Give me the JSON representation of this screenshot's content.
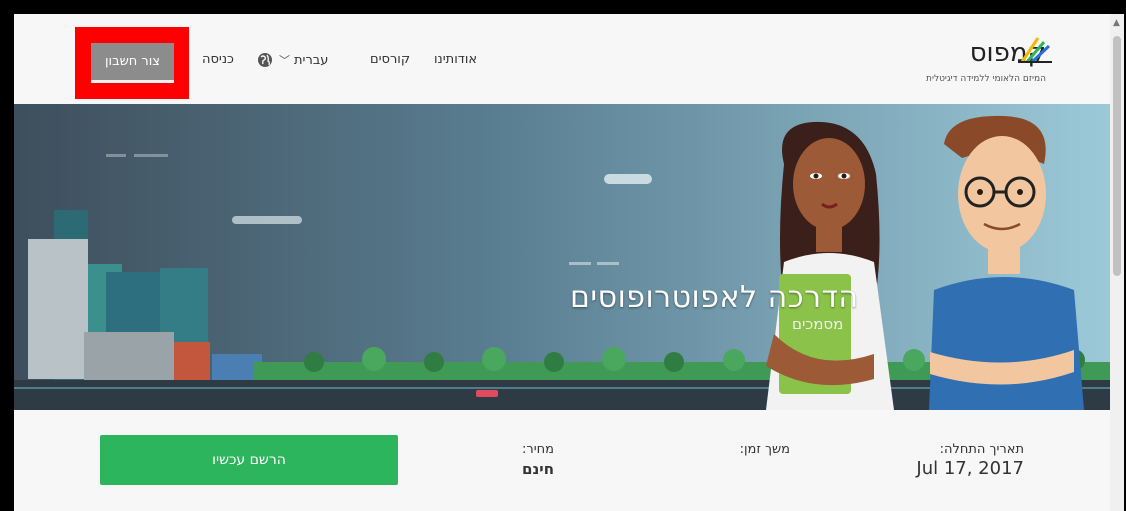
{
  "header": {
    "logo_text": "קמפוס",
    "logo_subtitle": "המיזם הלאומי ללמידה דיגיטלית",
    "nav": {
      "about": "אודותינו",
      "courses": "קורסים",
      "language": "עברית",
      "login": "כניסה",
      "signup": "צור חשבון"
    }
  },
  "banner": {
    "title": "הדרכה לאפוטרופוסים",
    "book_label": "מסמכים"
  },
  "info": {
    "start_label": "תאריך התחלה:",
    "start_value": "Jul 17, 2017",
    "duration_label": "משך זמן:",
    "price_label": "מחיר:",
    "price_value": "חינם",
    "register_label": "הרשם עכשיו"
  },
  "colors": {
    "register_green": "#2db55d",
    "signup_gray": "#8c8c8c",
    "highlight_red": "#ff0000"
  }
}
